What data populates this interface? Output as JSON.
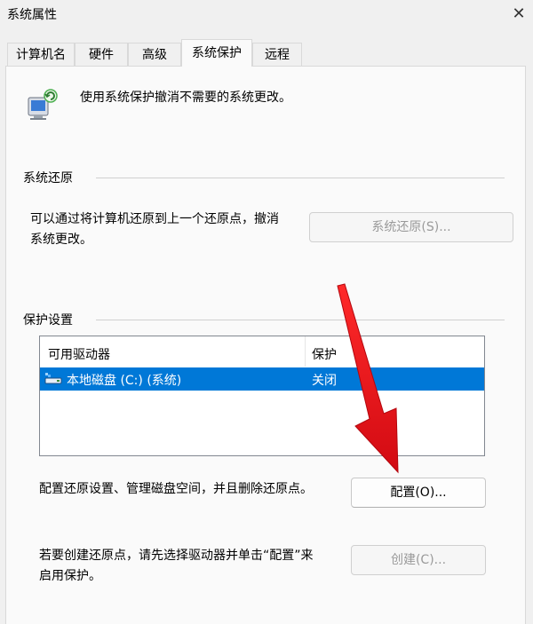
{
  "window": {
    "title": "系统属性",
    "close_glyph": "✕"
  },
  "tabs": [
    {
      "label": "计算机名",
      "active": false
    },
    {
      "label": "硬件",
      "active": false
    },
    {
      "label": "高级",
      "active": false
    },
    {
      "label": "系统保护",
      "active": true
    },
    {
      "label": "远程",
      "active": false
    }
  ],
  "intro": {
    "text": "使用系统保护撤消不需要的系统更改。"
  },
  "restore": {
    "group_label": "系统还原",
    "description_line1": "可以通过将计算机还原到上一个还原点，撤消",
    "description_line2": "系统更改。",
    "button_label": "系统还原(S)..."
  },
  "protection": {
    "group_label": "保护设置",
    "columns": {
      "drive": "可用驱动器",
      "protection": "保护"
    },
    "rows": [
      {
        "drive": "本地磁盘 (C:) (系统)",
        "protection": "关闭",
        "selected": true
      }
    ],
    "configure_text": "配置还原设置、管理磁盘空间，并且删除还原点。",
    "configure_button": "配置(O)...",
    "create_text_line1": "若要创建还原点，请先选择驱动器并单击“配置”来",
    "create_text_line2": "启用保护。",
    "create_button": "创建(C)..."
  },
  "colors": {
    "selection": "#0078d7",
    "arrow": "#e8141c"
  }
}
